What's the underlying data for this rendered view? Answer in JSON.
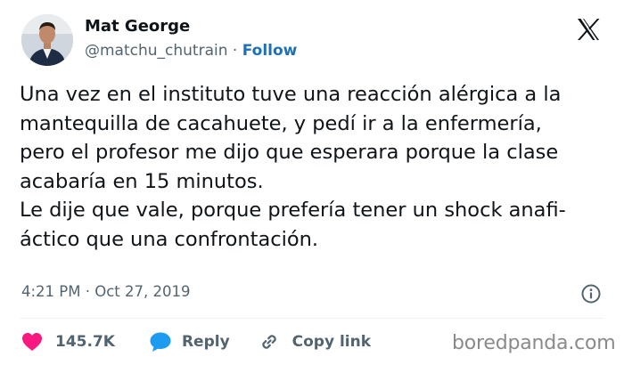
{
  "author": {
    "name": "Mat George",
    "handle": "@matchu_chutrain",
    "separator": "·",
    "follow_label": "Follow"
  },
  "tweet": {
    "text": "Una vez en el instituto tuve una reacción alérgica a la\nmantequilla de cacahuete, y pedí ir a la enfermería,\npero el profesor me dijo que esperara porque la clase\nacabaría en 15 minutos.\nLe dije que vale, porque prefería tener un shock anafi-\náctico que una confrontación.",
    "time": "4:21 PM",
    "date": "Oct 27, 2019",
    "meta_separator": "·"
  },
  "actions": {
    "likes_count": "145.7K",
    "reply_label": "Reply",
    "copy_link_label": "Copy link"
  },
  "watermark": "boredpanda.com",
  "icons": {
    "brand": "x-logo-icon",
    "info": "info-icon",
    "like": "heart-icon",
    "reply": "speech-bubble-icon",
    "copy": "link-icon"
  },
  "colors": {
    "text": "#0f1419",
    "secondary": "#536471",
    "follow": "#1d70b8",
    "like": "#f91880",
    "reply": "#1d9bf0",
    "divider": "#eff3f4"
  }
}
